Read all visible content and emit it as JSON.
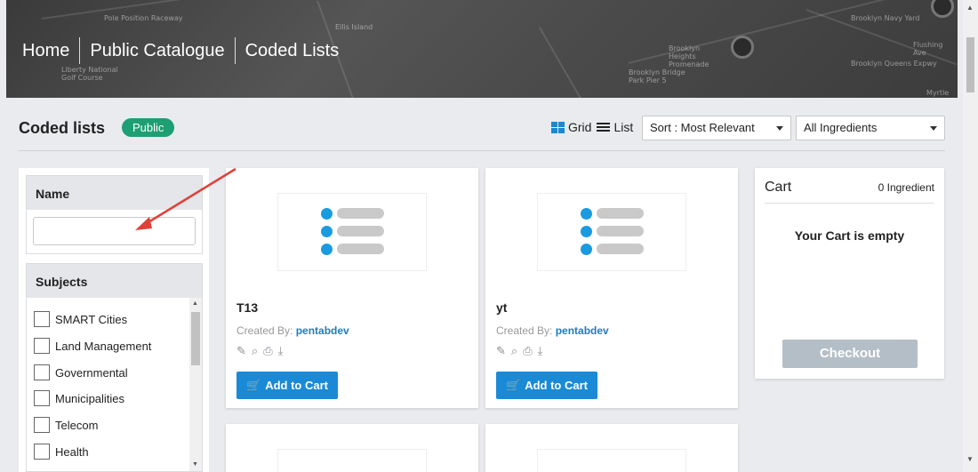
{
  "breadcrumb": [
    "Home",
    "Public Catalogue",
    "Coded Lists"
  ],
  "banner_labels": [
    "Pole Position Raceway",
    "Ellis Island",
    "Liberty National Golf Course",
    "Brooklyn Navy Yard",
    "Flushing Ave",
    "Brooklyn Heights Promenade",
    "Brooklyn Bridge Park Pier 5",
    "Brooklyn Queens Expwy",
    "Myrtle Ave"
  ],
  "header": {
    "title": "Coded lists",
    "badge": "Public",
    "grid_label": "Grid",
    "list_label": "List",
    "sort_value": "Sort : Most Relevant",
    "filter_value": "All Ingredients"
  },
  "filters": {
    "name_heading": "Name",
    "name_value": "",
    "subjects_heading": "Subjects",
    "subjects": [
      "SMART Cities",
      "Land Management",
      "Governmental",
      "Municipalities",
      "Telecom",
      "Health"
    ]
  },
  "cards": [
    {
      "title": "T13",
      "created_label": "Created By:",
      "author": "pentabdev",
      "button": "Add to Cart"
    },
    {
      "title": "yt",
      "created_label": "Created By:",
      "author": "pentabdev",
      "button": "Add to Cart"
    }
  ],
  "cart": {
    "title": "Cart",
    "count": "0 Ingredient",
    "empty": "Your Cart is empty",
    "checkout": "Checkout"
  },
  "colors": {
    "accent": "#1a8ad6",
    "badge": "#1e9e73",
    "annotation_arrow": "#e0403a"
  },
  "icons": [
    "grid-icon",
    "list-icon",
    "edit-icon",
    "search-icon",
    "print-icon",
    "download-icon",
    "cart-icon"
  ]
}
